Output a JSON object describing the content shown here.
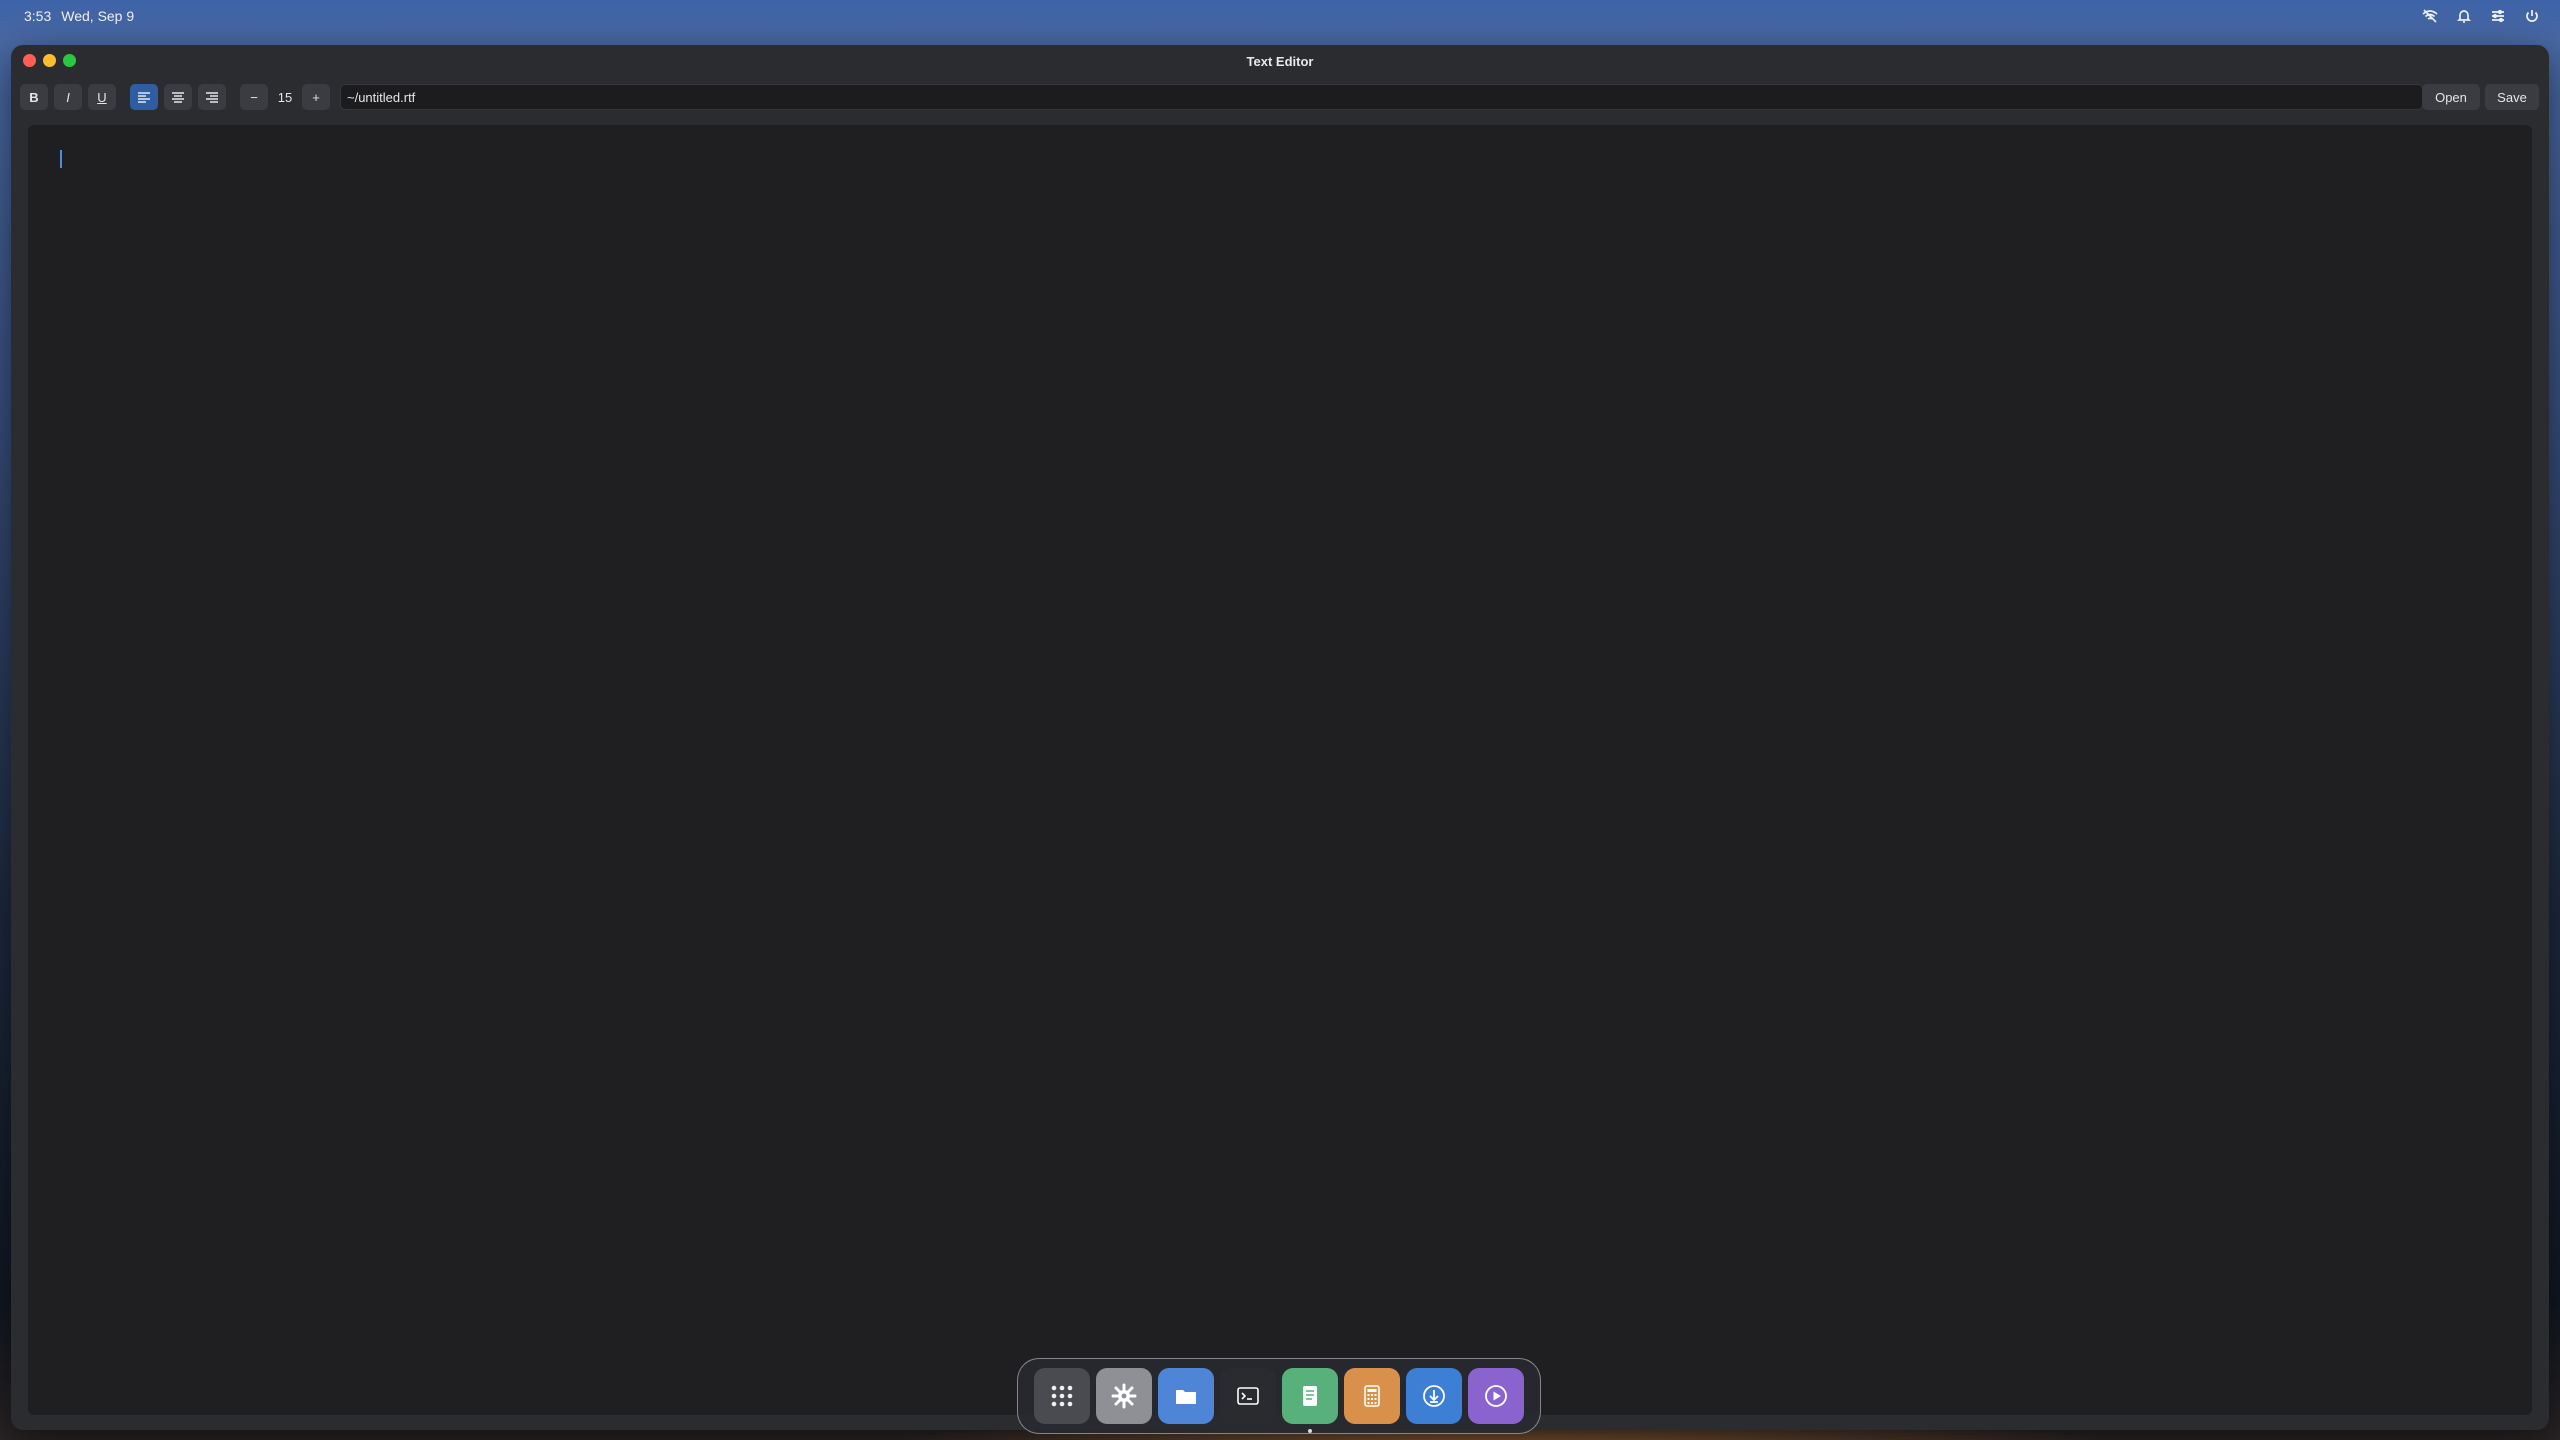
{
  "topbar": {
    "time": "3:53",
    "date": "Wed, Sep 9",
    "icons": [
      "network-icon",
      "bell-icon",
      "sliders-icon",
      "power-icon"
    ]
  },
  "window": {
    "title": "Text Editor",
    "controls": [
      "close",
      "minimize",
      "maximize"
    ]
  },
  "toolbar": {
    "bold": "B",
    "italic": "I",
    "underline": "U",
    "align": [
      "left",
      "center",
      "right"
    ],
    "align_active": "left",
    "decrease_label": "−",
    "font_size": "15",
    "increase_label": "+",
    "file_path": "~/untitled.rtf",
    "open_label": "Open",
    "save_label": "Save"
  },
  "editor": {
    "content": ""
  },
  "dock": {
    "apps": [
      {
        "name": "app-launcher",
        "icon": "grid-icon",
        "color": "#4a4b50"
      },
      {
        "name": "settings",
        "icon": "gear-icon",
        "color": "#8f9096"
      },
      {
        "name": "files",
        "icon": "folder-icon",
        "color": "#4f85d6"
      },
      {
        "name": "terminal",
        "icon": "terminal-icon",
        "color": "#2a2b2f"
      },
      {
        "name": "text-editor",
        "icon": "document-icon",
        "color": "#58b07a",
        "running": true
      },
      {
        "name": "calculator",
        "icon": "calculator-icon",
        "color": "#d9904a"
      },
      {
        "name": "downloader",
        "icon": "download-icon",
        "color": "#3d7fd4"
      },
      {
        "name": "media-player",
        "icon": "play-icon",
        "color": "#8a63cf"
      }
    ]
  },
  "colors": {
    "accent": "#2f5da4",
    "window_bg": "#2b2c30",
    "editor_bg": "#1f1f21",
    "caret": "#4a90e2"
  }
}
